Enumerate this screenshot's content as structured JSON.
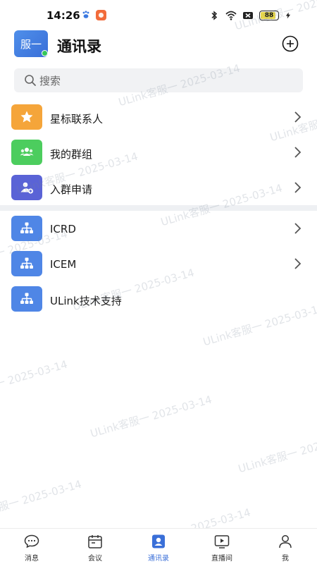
{
  "status_bar": {
    "time": "14:26",
    "battery": "88",
    "battery_level": 0.88
  },
  "header": {
    "avatar_text": "服一",
    "title": "通讯录"
  },
  "search": {
    "placeholder": "搜索"
  },
  "group_1": [
    {
      "label": "星标联系人",
      "icon": "star-icon",
      "color": "#f5a53a"
    },
    {
      "label": "我的群组",
      "icon": "group-icon",
      "color": "#4ccd5e"
    },
    {
      "label": "入群申请",
      "icon": "user-add-icon",
      "color": "#5a63d6"
    }
  ],
  "group_2": [
    {
      "label": "ICRD",
      "icon": "org-tree-icon",
      "color": "#4f86e6",
      "has_chevron": true
    },
    {
      "label": "ICEM",
      "icon": "org-tree-icon",
      "color": "#4f86e6",
      "has_chevron": true
    },
    {
      "label": "ULink技术支持",
      "icon": "org-tree-icon",
      "color": "#4f86e6",
      "has_chevron": false
    }
  ],
  "watermark": {
    "text": "ULink客服一 2025-03-14"
  },
  "tabs": [
    {
      "label": "消息",
      "icon": "chat-icon"
    },
    {
      "label": "会议",
      "icon": "calendar-icon"
    },
    {
      "label": "通讯录",
      "icon": "contacts-icon",
      "active": true
    },
    {
      "label": "直播间",
      "icon": "live-icon"
    },
    {
      "label": "我",
      "icon": "person-icon"
    }
  ],
  "colors": {
    "accent": "#3a6fd8",
    "tab_inactive": "#333333"
  }
}
